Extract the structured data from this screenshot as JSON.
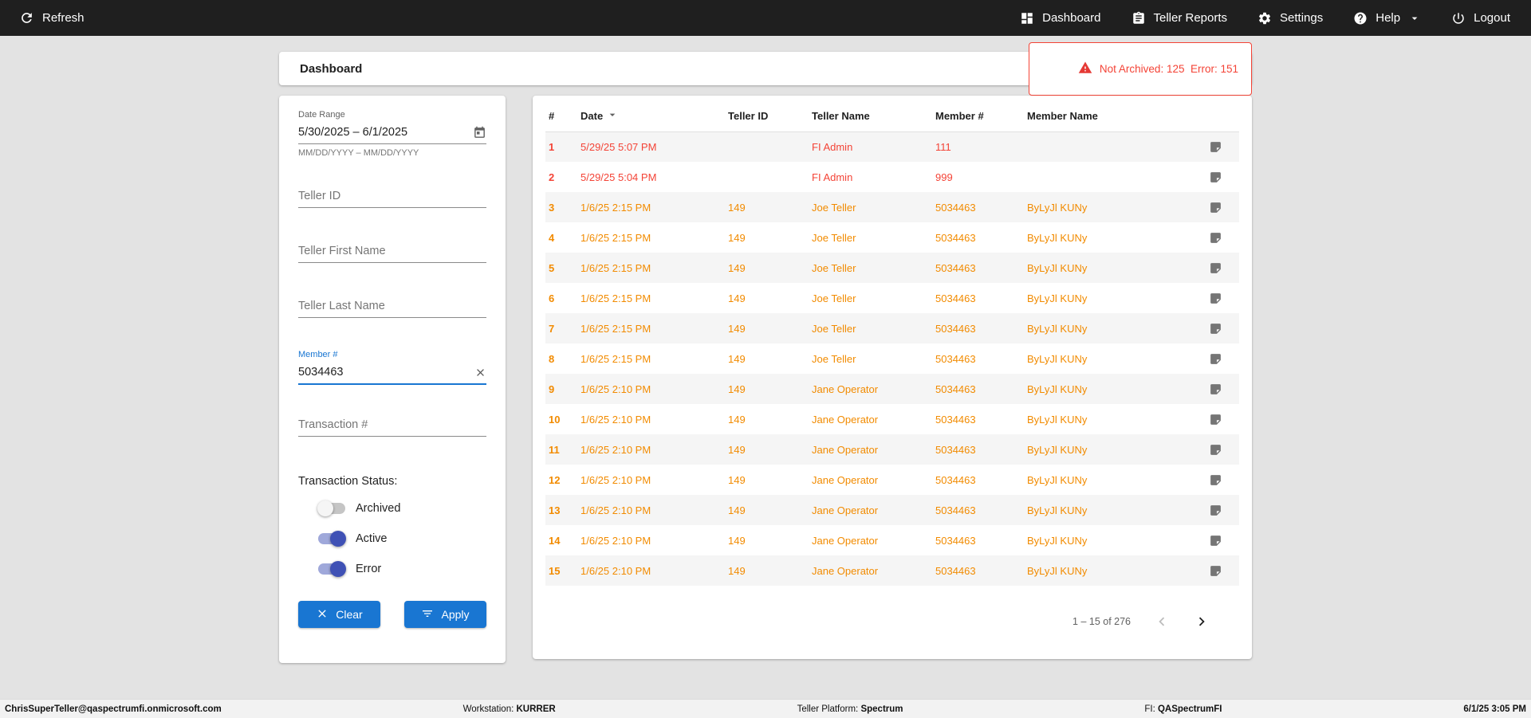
{
  "colors": {
    "accent": "#1976d2",
    "toggle_on": "#3f51b5",
    "error_text": "#f44336",
    "warning_text": "#f28b00",
    "topbar_bg": "#1f1f1f"
  },
  "topbar": {
    "refresh_label": "Refresh",
    "nav": [
      {
        "icon": "dashboard-icon",
        "label": "Dashboard"
      },
      {
        "icon": "teller-reports-icon",
        "label": "Teller Reports"
      },
      {
        "icon": "settings-icon",
        "label": "Settings"
      },
      {
        "icon": "help-icon",
        "label": "Help"
      },
      {
        "icon": "logout-icon",
        "label": "Logout"
      }
    ]
  },
  "header": {
    "title": "Dashboard",
    "alert_text": "Not Archived: 125  Error: 151"
  },
  "filters": {
    "date_range": {
      "label": "Date Range",
      "value": "5/30/2025 – 6/1/2025",
      "hint": "MM/DD/YYYY – MM/DD/YYYY"
    },
    "teller_id_placeholder": "Teller ID",
    "teller_first_placeholder": "Teller First Name",
    "teller_last_placeholder": "Teller Last Name",
    "member": {
      "label": "Member #",
      "value": "5034463"
    },
    "transaction_placeholder": "Transaction #",
    "status_label": "Transaction Status:",
    "toggles": [
      {
        "label": "Archived",
        "on": false
      },
      {
        "label": "Active",
        "on": true
      },
      {
        "label": "Error",
        "on": true
      }
    ],
    "clear_label": "Clear",
    "apply_label": "Apply"
  },
  "table": {
    "columns": [
      "#",
      "Date",
      "Teller ID",
      "Teller Name",
      "Member #",
      "Member Name"
    ],
    "rows": [
      {
        "num": "1",
        "date": "5/29/25 5:07 PM",
        "teller_id": "",
        "teller_name": "FI Admin",
        "member_num": "111",
        "member_name": "",
        "status": "error"
      },
      {
        "num": "2",
        "date": "5/29/25 5:04 PM",
        "teller_id": "",
        "teller_name": "FI Admin",
        "member_num": "999",
        "member_name": "",
        "status": "error"
      },
      {
        "num": "3",
        "date": "1/6/25 2:15 PM",
        "teller_id": "149",
        "teller_name": "Joe Teller",
        "member_num": "5034463",
        "member_name": "ByLyJl KUNy",
        "status": "warning"
      },
      {
        "num": "4",
        "date": "1/6/25 2:15 PM",
        "teller_id": "149",
        "teller_name": "Joe Teller",
        "member_num": "5034463",
        "member_name": "ByLyJl KUNy",
        "status": "warning"
      },
      {
        "num": "5",
        "date": "1/6/25 2:15 PM",
        "teller_id": "149",
        "teller_name": "Joe Teller",
        "member_num": "5034463",
        "member_name": "ByLyJl KUNy",
        "status": "warning"
      },
      {
        "num": "6",
        "date": "1/6/25 2:15 PM",
        "teller_id": "149",
        "teller_name": "Joe Teller",
        "member_num": "5034463",
        "member_name": "ByLyJl KUNy",
        "status": "warning"
      },
      {
        "num": "7",
        "date": "1/6/25 2:15 PM",
        "teller_id": "149",
        "teller_name": "Joe Teller",
        "member_num": "5034463",
        "member_name": "ByLyJl KUNy",
        "status": "warning"
      },
      {
        "num": "8",
        "date": "1/6/25 2:15 PM",
        "teller_id": "149",
        "teller_name": "Joe Teller",
        "member_num": "5034463",
        "member_name": "ByLyJl KUNy",
        "status": "warning"
      },
      {
        "num": "9",
        "date": "1/6/25 2:10 PM",
        "teller_id": "149",
        "teller_name": "Jane Operator",
        "member_num": "5034463",
        "member_name": "ByLyJl KUNy",
        "status": "warning"
      },
      {
        "num": "10",
        "date": "1/6/25 2:10 PM",
        "teller_id": "149",
        "teller_name": "Jane Operator",
        "member_num": "5034463",
        "member_name": "ByLyJl KUNy",
        "status": "warning"
      },
      {
        "num": "11",
        "date": "1/6/25 2:10 PM",
        "teller_id": "149",
        "teller_name": "Jane Operator",
        "member_num": "5034463",
        "member_name": "ByLyJl KUNy",
        "status": "warning"
      },
      {
        "num": "12",
        "date": "1/6/25 2:10 PM",
        "teller_id": "149",
        "teller_name": "Jane Operator",
        "member_num": "5034463",
        "member_name": "ByLyJl KUNy",
        "status": "warning"
      },
      {
        "num": "13",
        "date": "1/6/25 2:10 PM",
        "teller_id": "149",
        "teller_name": "Jane Operator",
        "member_num": "5034463",
        "member_name": "ByLyJl KUNy",
        "status": "warning"
      },
      {
        "num": "14",
        "date": "1/6/25 2:10 PM",
        "teller_id": "149",
        "teller_name": "Jane Operator",
        "member_num": "5034463",
        "member_name": "ByLyJl KUNy",
        "status": "warning"
      },
      {
        "num": "15",
        "date": "1/6/25 2:10 PM",
        "teller_id": "149",
        "teller_name": "Jane Operator",
        "member_num": "5034463",
        "member_name": "ByLyJl KUNy",
        "status": "warning"
      }
    ],
    "pagination": "1 – 15 of 276"
  },
  "footer": {
    "user": "ChrisSuperTeller@qaspectrumfi.onmicrosoft.com",
    "workstation_label": "Workstation:",
    "workstation": "KURRER",
    "platform_label": "Teller Platform:",
    "platform": "Spectrum",
    "fi_label": "FI:",
    "fi": "QASpectrumFI",
    "datetime": "6/1/25 3:05 PM"
  }
}
